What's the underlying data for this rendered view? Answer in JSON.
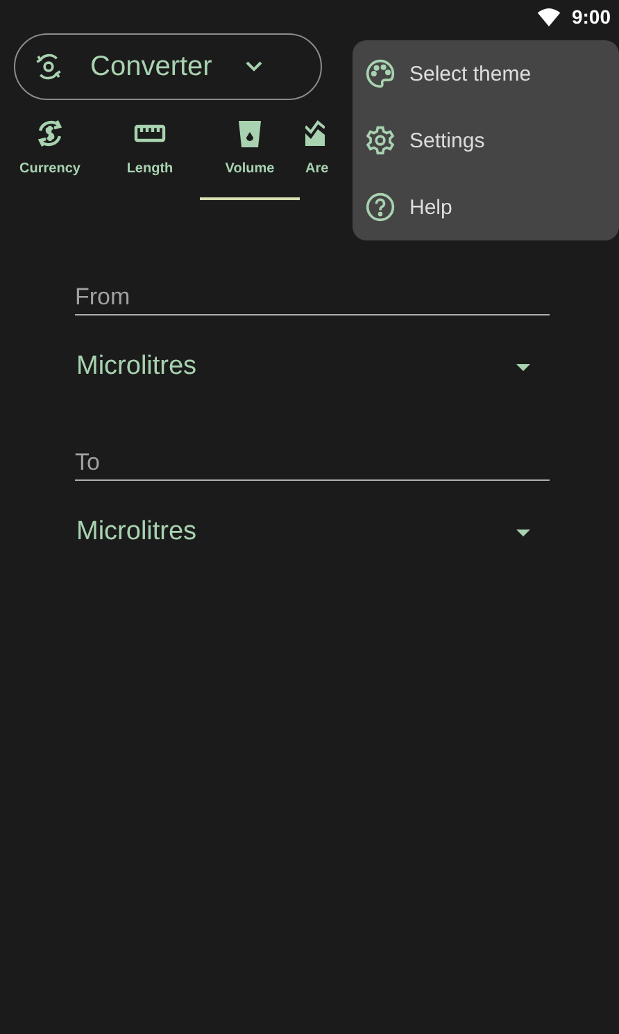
{
  "status_bar": {
    "time": "9:00"
  },
  "app_selector": {
    "label": "Converter"
  },
  "tabs": [
    {
      "label": "Currency",
      "kind": "currency",
      "selected": false
    },
    {
      "label": "Length",
      "kind": "length",
      "selected": false
    },
    {
      "label": "Volume",
      "kind": "volume",
      "selected": true
    },
    {
      "label": "Are",
      "kind": "area",
      "selected": false
    }
  ],
  "menu": [
    {
      "label": "Select theme",
      "kind": "palette"
    },
    {
      "label": "Settings",
      "kind": "gear"
    },
    {
      "label": "Help",
      "kind": "help"
    }
  ],
  "fields": [
    {
      "placeholder": "From",
      "unit": "Microlitres"
    },
    {
      "placeholder": "To",
      "unit": "Microlitres"
    }
  ]
}
